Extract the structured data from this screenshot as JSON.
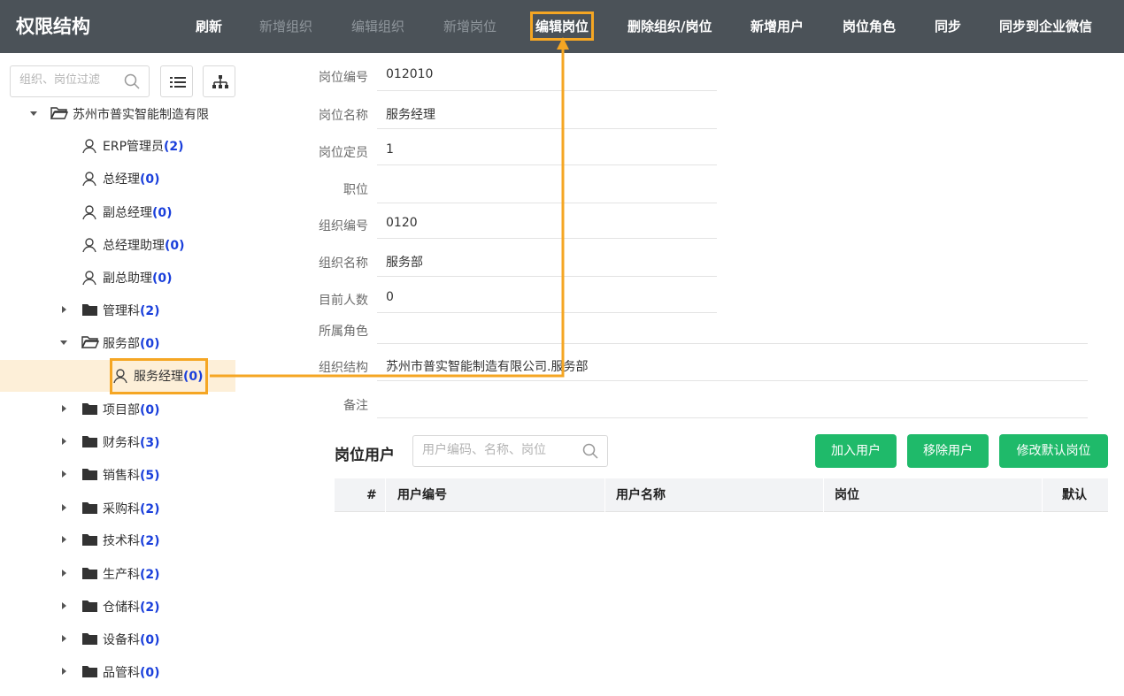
{
  "app": {
    "title": "权限结构"
  },
  "toolbar": {
    "refresh": "刷新",
    "add_org": "新增组织",
    "edit_org": "编辑组织",
    "add_post": "新增岗位",
    "edit_post": "编辑岗位",
    "delete_org_post": "删除组织/岗位",
    "add_user": "新增用户",
    "post_role": "岗位角色",
    "sync": "同步",
    "sync_wecom": "同步到企业微信"
  },
  "sidebar": {
    "search_placeholder": "组织、岗位过滤",
    "tree": [
      {
        "label": "苏州市普实智能制造有限",
        "count": ""
      },
      {
        "label": "ERP管理员",
        "count": "(2)"
      },
      {
        "label": "总经理",
        "count": "(0)"
      },
      {
        "label": "副总经理",
        "count": "(0)"
      },
      {
        "label": "总经理助理",
        "count": "(0)"
      },
      {
        "label": "副总助理",
        "count": "(0)"
      },
      {
        "label": "管理科",
        "count": "(2)"
      },
      {
        "label": "服务部",
        "count": "(0)"
      },
      {
        "label": "服务经理",
        "count": "(0)"
      },
      {
        "label": "项目部",
        "count": "(0)"
      },
      {
        "label": "财务科",
        "count": "(3)"
      },
      {
        "label": "销售科",
        "count": "(5)"
      },
      {
        "label": "采购科",
        "count": "(2)"
      },
      {
        "label": "技术科",
        "count": "(2)"
      },
      {
        "label": "生产科",
        "count": "(2)"
      },
      {
        "label": "仓储科",
        "count": "(2)"
      },
      {
        "label": "设备科",
        "count": "(0)"
      },
      {
        "label": "品管科",
        "count": "(0)"
      }
    ]
  },
  "form": {
    "post_code_label": "岗位编号",
    "post_code": "012010",
    "post_name_label": "岗位名称",
    "post_name": "服务经理",
    "headcount_label": "岗位定员",
    "headcount": "1",
    "rank_label": "职位",
    "rank": "",
    "org_code_label": "组织编号",
    "org_code": "0120",
    "org_name_label": "组织名称",
    "org_name": "服务部",
    "current_count_label": "目前人数",
    "current_count": "0",
    "roles_label": "所属角色",
    "roles": "",
    "org_path_label": "组织结构",
    "org_path": "苏州市普实智能制造有限公司.服务部",
    "remark_label": "备注",
    "remark": ""
  },
  "users": {
    "title": "岗位用户",
    "search_placeholder": "用户编码、名称、岗位",
    "add_btn": "加入用户",
    "remove_btn": "移除用户",
    "default_btn": "修改默认岗位",
    "columns": [
      "#",
      "用户编号",
      "用户名称",
      "岗位",
      "默认"
    ]
  },
  "colors": {
    "topbar": "#4b5258",
    "accent": "#f5a623",
    "green": "#1fba6a",
    "count": "#1a3fdb"
  }
}
